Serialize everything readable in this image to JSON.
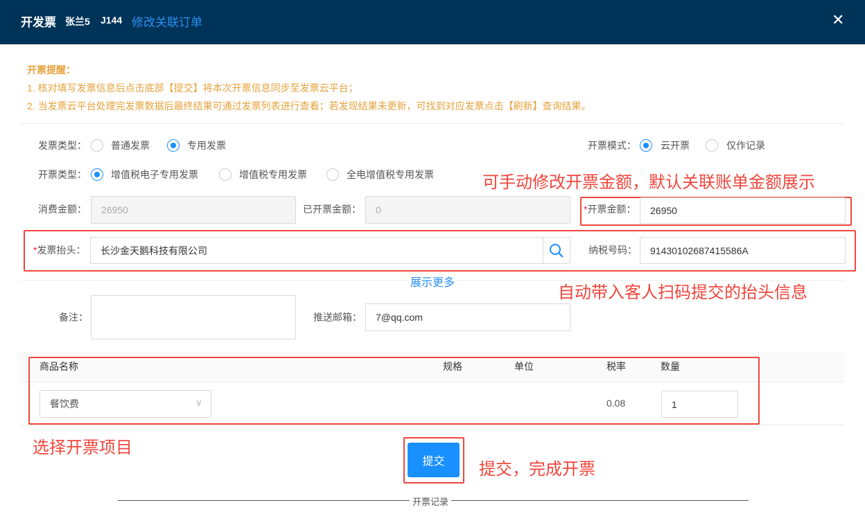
{
  "header": {
    "title": "开发票",
    "customer": "张兰5",
    "table": "J144",
    "edit_link": "修改关联订单",
    "close_icon": "close-icon"
  },
  "notice": {
    "title": "开票提醒：",
    "lines": [
      "1. 核对填写发票信息后点击底部【提交】将本次开票信息同步至发票云平台；",
      "2. 当发票云平台处理完发票数据后最终结果可通过发票列表进行查看；若发现结果未更新，可找到对应发票点击【刷新】查询结果。"
    ]
  },
  "form": {
    "invoice_type": {
      "label": "发票类型：",
      "options": [
        "普通发票",
        "专用发票"
      ],
      "selected": "专用发票"
    },
    "mode": {
      "label": "开票模式：",
      "options": [
        "云开票",
        "仅作记录"
      ],
      "selected": "云开票"
    },
    "billing_type": {
      "label": "开票类型：",
      "options": [
        "增值税电子专用发票",
        "增值税专用发票",
        "全电增值税专用发票"
      ],
      "selected": "增值税电子专用发票"
    },
    "consume_amount": {
      "label": "消费金额：",
      "value": "26950"
    },
    "invoiced_amount": {
      "label": "已开票金额：",
      "value": "0"
    },
    "invoice_amount": {
      "required": "*",
      "label": "开票金额：",
      "value": "26950"
    },
    "title_field": {
      "required": "*",
      "label": "发票抬头：",
      "value": "长沙金天鹅科技有限公司"
    },
    "tax_no": {
      "label": "纳税号码：",
      "value": "91430102687415586A"
    },
    "show_more": "展示更多",
    "remark": {
      "label": "备注：",
      "value": ""
    },
    "email": {
      "label": "推送邮箱：",
      "value": "7@qq.com"
    }
  },
  "table": {
    "headers": [
      "商品名称",
      "规格",
      "单位",
      "税率",
      "数量"
    ],
    "rows": [
      {
        "name": "餐饮费",
        "spec": "",
        "unit": "",
        "rate": "0.08",
        "qty": "1"
      }
    ]
  },
  "submit_label": "提交",
  "records_label": "开票记录",
  "annotations": [
    "可手动修改开票金额，默认关联账单金额展示",
    "自动带入客人扫码提交的抬头信息",
    "选择开票项目",
    "提交，完成开票"
  ],
  "colors": {
    "header_bg": "#003358",
    "accent": "#1890ff",
    "warning": "#e6a23c",
    "annotation": "#f0463c"
  }
}
